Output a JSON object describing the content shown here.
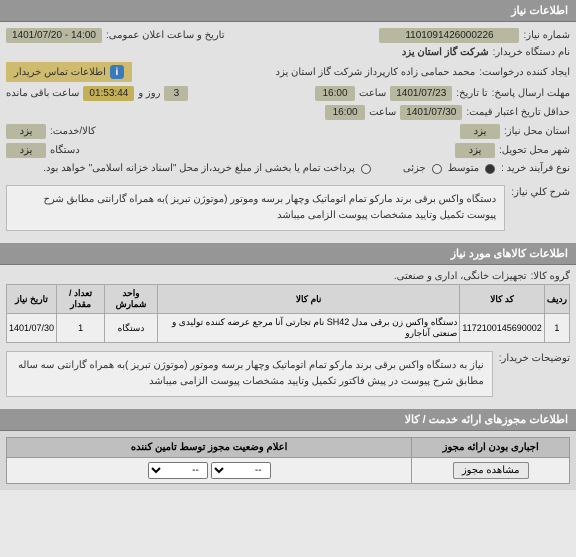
{
  "header1": "اطلاعات نیاز",
  "labels": {
    "need_no": "شماره نیاز:",
    "ann_datetime": "تاریخ و ساعت اعلان عمومی:",
    "buyer": "نام دستگاه خریدار:",
    "requester": "ایجاد کننده درخواست:",
    "contact": "اطلاعات تماس خریدار",
    "send_time": "مهلت ارسال پاسخ:",
    "until": "تا تاریخ:",
    "hour": "ساعت",
    "day_and": "روز و",
    "remaining": "ساعت باقی مانده",
    "min_validity": "حداقل تاریخ اعتبار قیمت:",
    "city_need": "استان محل نیاز:",
    "city_deliver": "شهر محل تحویل:",
    "goods_service": "کالا/خدمت:",
    "device": "دستگاه",
    "buy_type": "نوع فرآیند خرید :",
    "partial_pay": "پرداخت تمام یا بخشی از مبلغ خرید،از محل \"اسناد خزانه اسلامی\" خواهد بود.",
    "need_desc": "شرح کلي نياز:",
    "goods_info_header": "اطلاعات کالاهای مورد نیاز",
    "goods_group": "گروه کالا:",
    "buyer_notes": "توضیحات خریدار:",
    "permits_header": "اطلاعات مجوزهای ارائه خدمت / کالا",
    "mandatory": "اجباری بودن ارائه مجوز",
    "permit_status": "اعلام وضعیت مجوز توسط تامین کننده",
    "view_permit": "مشاهده مجوز"
  },
  "values": {
    "need_no": "1101091426000226",
    "ann_date": "1401/07/20",
    "ann_time": "14:00",
    "sep": " - ",
    "buyer": "شرکت گاز استان یزد",
    "requester": "محمد حمامی زاده کارپرداز شرکت گاز استان یزد",
    "send_date": "1401/07/23",
    "send_hour": "16:00",
    "days": "3",
    "countdown": "01:53:44",
    "validity_date": "1401/07/30",
    "validity_hour": "16:00",
    "city1": "یزد",
    "city2": "یزد",
    "goods_service": "یزد",
    "device": "یزد",
    "buy_type_current": "متوسط",
    "desc": "دستگاه واکس برقی برند مارکو تمام اتوماتیک وچهار برسه وموتور (موتوژن تبریز )به همراه گارانتی مطابق شرح پیوست تکمیل وتایید مشخصات پیوست الزامی میباشد",
    "goods_group": "تجهیزات خانگی، اداری و صنعتی.",
    "buyer_notes": "نیاز به دستگاه واکس برقی برند مارکو تمام اتوماتیک وچهار برسه وموتور (موتوژن تبریز )به همراه گارانتی سه ساله مطابق شرح پیوست در پیش فاکتور تکمیل وتایید مشخصات پیوست الزامی میباشد"
  },
  "radio": {
    "opt_mid": "متوسط",
    "opt_small": "جزئی"
  },
  "items_table": {
    "headers": [
      "ردیف",
      "کد کالا",
      "نام کالا",
      "واحد شمارش",
      "تعداد / مقدار",
      "تاریخ نیاز"
    ],
    "rows": [
      {
        "idx": "1",
        "code": "1172100145690002",
        "name": "دستگاه واکس زن برقی مدل SH42 نام تجارتی آنا مرجع عرضه کننده تولیدی و صنعتی آناجارو",
        "unit": "دستگاه",
        "qty": "1",
        "date": "1401/07/30"
      }
    ]
  },
  "bottom": {
    "select_placeholder": "--"
  }
}
